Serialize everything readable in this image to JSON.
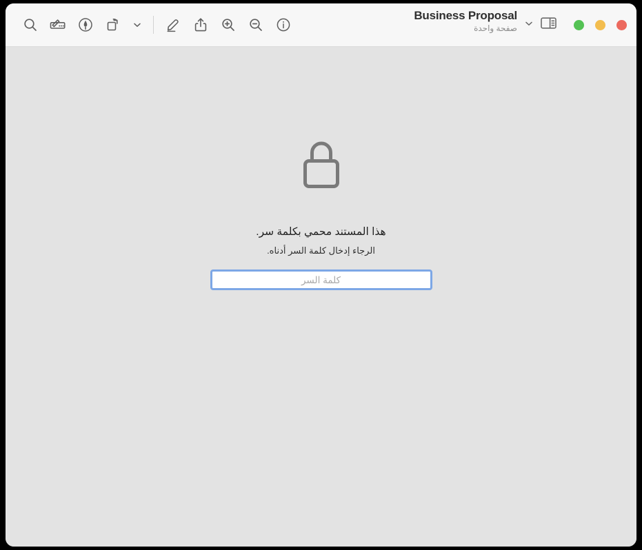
{
  "window": {
    "title": "Business Proposal",
    "subtitle": "صفحة واحدة",
    "background_color": "#e3e3e3",
    "toolbar_color": "#f7f7f7"
  },
  "traffic_lights": {
    "green_label": "تصغير إلى ملء الشاشة",
    "yellow_label": "تصغير",
    "red_label": "إغلاق",
    "green_color": "#54c254",
    "yellow_color": "#f3bd4e",
    "red_color": "#ec695e"
  },
  "toolbar": {
    "items": [
      {
        "name": "search-icon",
        "label": "بحث"
      },
      {
        "name": "markup-toolbar-icon",
        "label": "إظهار شريط أدوات التوصيف"
      },
      {
        "name": "sign-icon",
        "label": "توقيع"
      },
      {
        "name": "rotate-icon",
        "label": "تدوير"
      },
      {
        "name": "chevron-down-icon",
        "label": "المزيد"
      },
      {
        "name": "highlight-icon",
        "label": "تمييز"
      },
      {
        "name": "share-icon",
        "label": "مشاركة"
      },
      {
        "name": "zoom-in-icon",
        "label": "تكبير"
      },
      {
        "name": "zoom-out-icon",
        "label": "تصغير"
      },
      {
        "name": "info-icon",
        "label": "معلومات"
      }
    ],
    "title_chevron": {
      "name": "chevron-down-icon",
      "label": "خيارات المستند"
    },
    "sidebar_toggle": {
      "name": "sidebar-icon",
      "label": "إظهار الشريط الجانبي"
    }
  },
  "locked_document": {
    "lock_icon": "lock-icon",
    "line1": "هذا المستند محمي بكلمة سر.",
    "line2": "الرجاء إدخال كلمة السر أدناه.",
    "password_placeholder": "كلمة السر",
    "password_value": "",
    "focus_ring_color": "#7da7e6"
  }
}
